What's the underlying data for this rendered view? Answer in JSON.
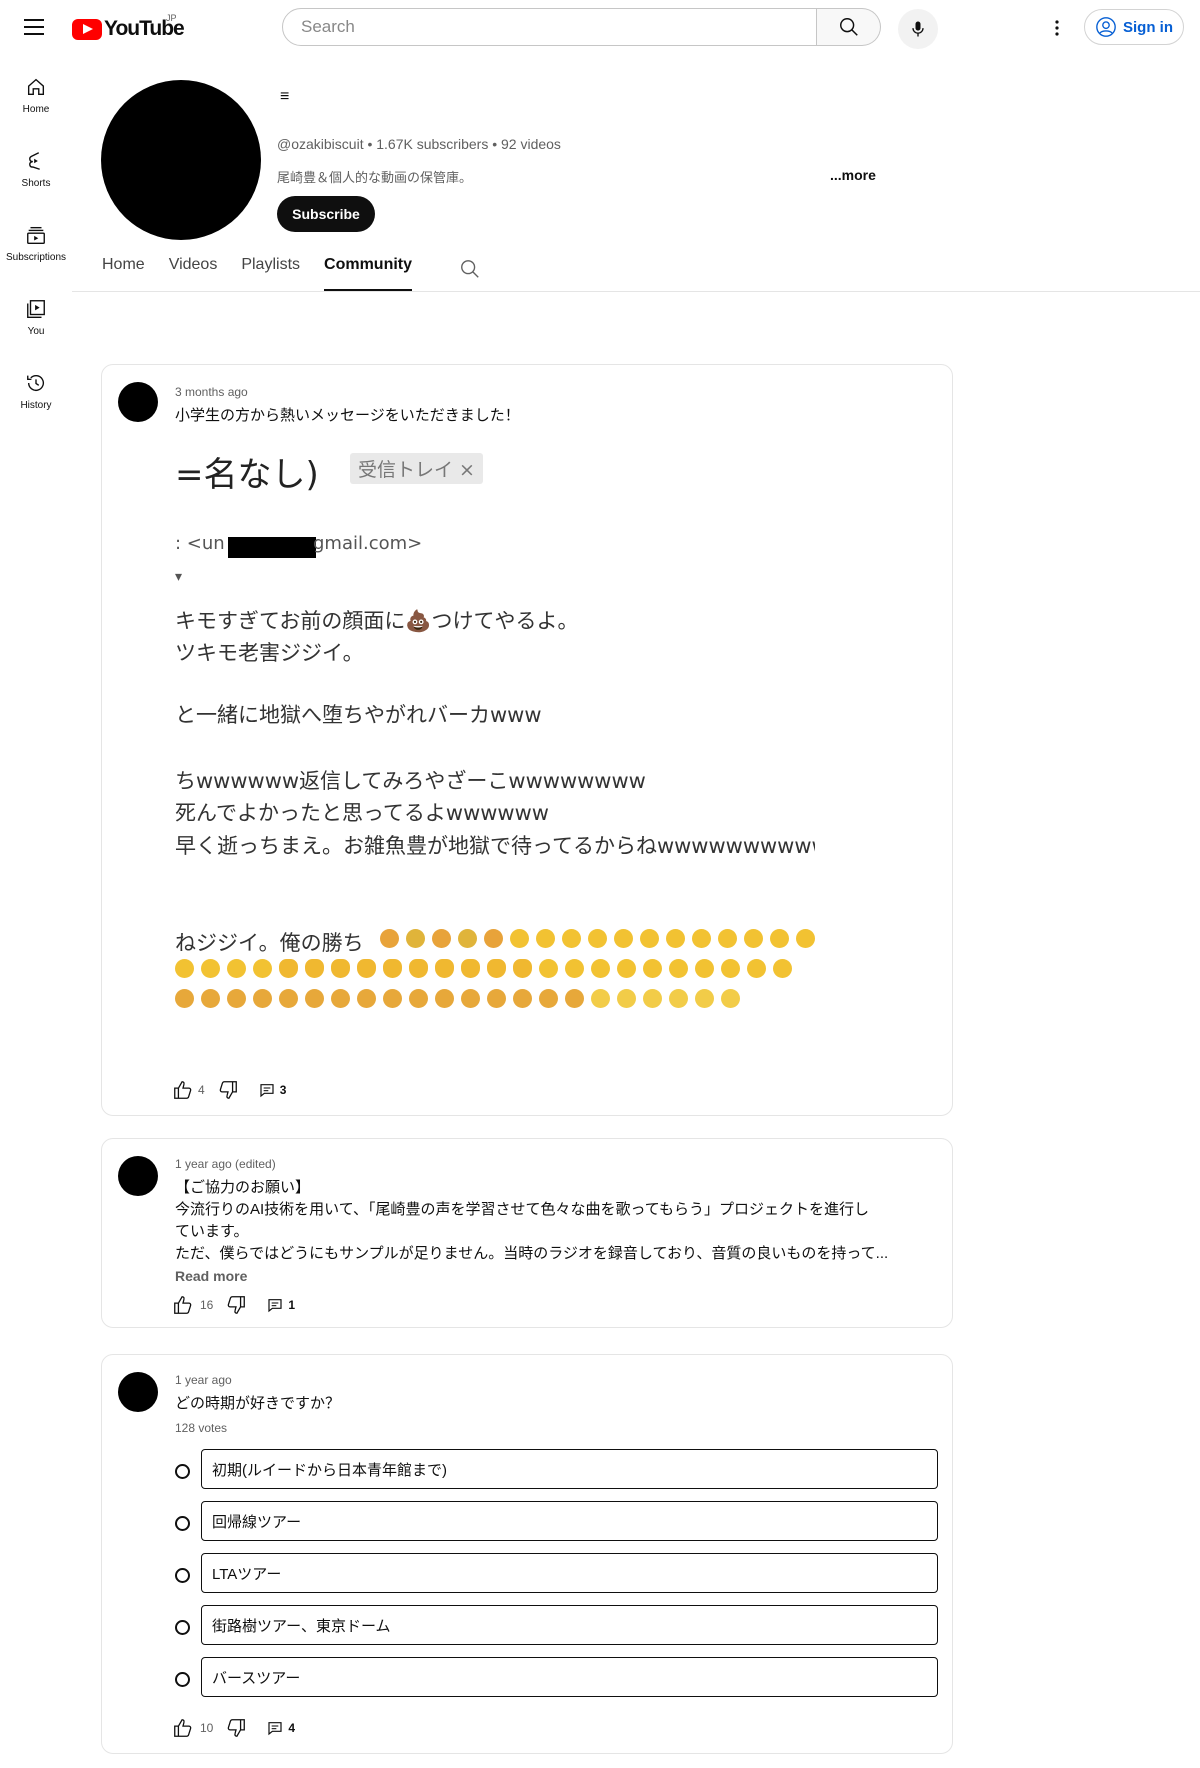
{
  "header": {
    "logo_text": "YouTube",
    "country_code": "JP",
    "search_placeholder": "Search",
    "signin_label": "Sign in"
  },
  "sidebar": {
    "items": [
      {
        "label": "Home"
      },
      {
        "label": "Shorts"
      },
      {
        "label": "Subscriptions"
      },
      {
        "label": "You"
      },
      {
        "label": "History"
      }
    ]
  },
  "channel": {
    "name": "≡",
    "meta": "@ozakibiscuit • 1.67K subscribers • 92 videos",
    "description": "尾崎豊＆個人的な動画の保管庫。",
    "more_label": "...more",
    "subscribe_label": "Subscribe"
  },
  "tabs": [
    {
      "label": "Home"
    },
    {
      "label": "Videos"
    },
    {
      "label": "Playlists"
    },
    {
      "label": "Community"
    }
  ],
  "posts": [
    {
      "time": "3 months ago",
      "text": "小学生の方から熱いメッセージをいただきました！",
      "image_lines": [
        "=名なし)",
        "受信トレイ ×",
        ": <un",
        "gmail.com>",
        "キモすぎてお前の顔面に💩つけてやるよ。",
        "ツキモ老害ジジイ。",
        "と一緒に地獄へ堕ちやがれバーカwww",
        "ちwwwwww返信してみろやざーこwwwwwwww",
        "死んでよかったと思ってるよwwwwww",
        "早く逝っちまえ。お雑魚豊が地獄で待ってるからねwwwwwwwwwww",
        "ねジジイ。俺の勝ち"
      ],
      "likes": "4",
      "comments": "3"
    },
    {
      "time": "1 year ago (edited)",
      "text_lines": [
        "【ご協力のお願い】",
        "今流行りのAI技術を用いて、「尾崎豊の声を学習させて色々な曲を歌ってもらう」プロジェクトを進行し",
        "ています。",
        "ただ、僕らではどうにもサンプルが足りません。当時のラジオを録音しており、音質の良いものを持って..."
      ],
      "read_more": "Read more",
      "likes": "16",
      "comments": "1"
    },
    {
      "time": "1 year ago",
      "question": "どの時期が好きですか？",
      "votes": "128 votes",
      "options": [
        "初期(ルイードから日本青年館まで)",
        "回帰線ツアー",
        "LTAツアー",
        "街路樹ツアー、東京ドーム",
        "バースツアー"
      ],
      "likes": "10",
      "comments": "4"
    }
  ]
}
